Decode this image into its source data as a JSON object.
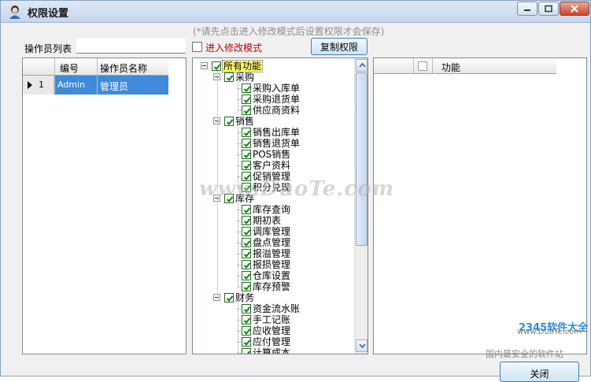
{
  "window": {
    "title": "权限设置",
    "app_icon": "user-avatar-icon"
  },
  "hint": "(*请先点击进入修改模式后设置权限才会保存)",
  "operator_label": "操作员列表",
  "operator_filter_value": "",
  "edit_mode": {
    "label": "进入修改模式",
    "checked": false
  },
  "copy_button": "复制权限",
  "operators": {
    "headers": {
      "code": "编号",
      "name": "操作员名称"
    },
    "rows": [
      {
        "index": "1",
        "code": "Admin",
        "name": "管理员"
      }
    ]
  },
  "tree": {
    "root": "所有功能",
    "groups": [
      {
        "label": "采购",
        "items": [
          "采购入库单",
          "采购退货单",
          "供应商资料"
        ]
      },
      {
        "label": "销售",
        "items": [
          "销售出库单",
          "销售退货单",
          "POS销售",
          "客户资料",
          "促销管理",
          "积分兑现"
        ]
      },
      {
        "label": "库存",
        "items": [
          "库存查询",
          "期初表",
          "调库管理",
          "盘点管理",
          "报溢管理",
          "报损管理",
          "仓库设置",
          "库存预警"
        ]
      },
      {
        "label": "财务",
        "items": [
          "资金流水账",
          "手工记账",
          "应收管理",
          "应付管理",
          "计算成本"
        ]
      }
    ]
  },
  "function_panel": {
    "header": "功能"
  },
  "close_button": "关闭",
  "watermarks": {
    "center": "www.DuoTe.com",
    "corner_small": "www.DuoTe.com",
    "brand": "2345软件大全",
    "slogan": "国内最安全的软件站"
  },
  "colors": {
    "selection": "#3f8ad9",
    "mode_label": "#c00000",
    "check": "#1a7a1a",
    "root_highlight": "#ffff66"
  }
}
